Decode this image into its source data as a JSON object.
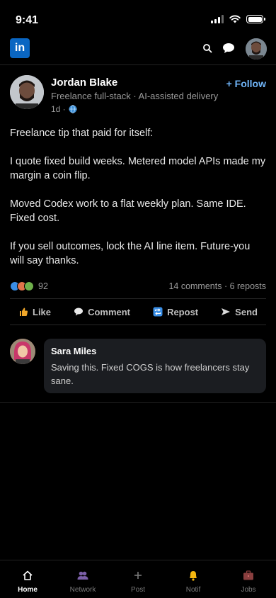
{
  "status_bar": {
    "time": "9:41"
  },
  "header": {
    "logo_text": "in",
    "search_icon": "search-icon",
    "messaging_icon": "chat-bubble-icon"
  },
  "post": {
    "author": {
      "name": "Jordan Blake",
      "headline": "Freelance full-stack · AI-assisted delivery",
      "time": "1d ·"
    },
    "follow_label": "+ Follow",
    "paragraphs": [
      "Freelance tip that paid for itself:",
      "I quote fixed build weeks. Metered model APIs made my margin a coin flip.",
      "Moved Codex work to a flat weekly plan. Same IDE. Fixed cost.",
      "If you sell outcomes, lock the AI line item. Future-you will say thanks."
    ],
    "reactions_count": "92",
    "engagement": "14 comments · 6 reposts",
    "actions": [
      {
        "label": "Like",
        "icon": "thumbs-up-icon"
      },
      {
        "label": "Comment",
        "icon": "comment-icon"
      },
      {
        "label": "Repost",
        "icon": "repost-icon"
      },
      {
        "label": "Send",
        "icon": "send-icon"
      }
    ]
  },
  "comment": {
    "name": "Sara Miles",
    "text": "Saving this. Fixed COGS is how freelancers stay sane."
  },
  "bottom_nav": [
    {
      "label": "Home",
      "icon": "home-icon",
      "active": true
    },
    {
      "label": "Network",
      "icon": "network-icon",
      "active": false
    },
    {
      "label": "Post",
      "icon": "plus-icon",
      "active": false
    },
    {
      "label": "Notif",
      "icon": "bell-icon",
      "active": false
    },
    {
      "label": "Jobs",
      "icon": "briefcase-icon",
      "active": false
    }
  ],
  "colors": {
    "brand": "#0a66c2",
    "follow": "#70b5f9",
    "background": "#000000"
  }
}
